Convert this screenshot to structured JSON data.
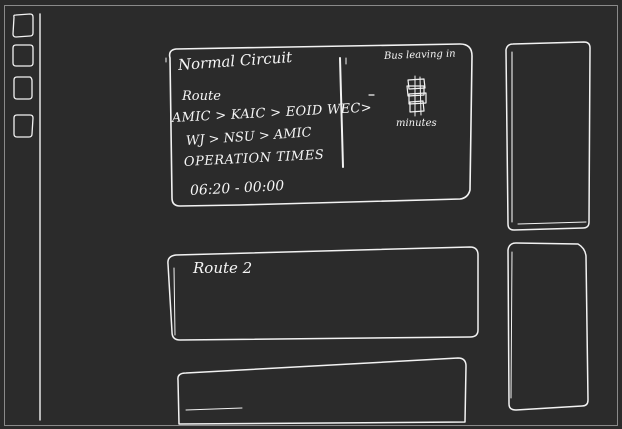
{
  "sidebar": {
    "items": [
      {
        "name": "sidebar-item-1"
      },
      {
        "name": "sidebar-item-2"
      },
      {
        "name": "sidebar-item-3"
      },
      {
        "name": "sidebar-item-4"
      }
    ]
  },
  "card_normal_circuit": {
    "title": "Normal Circuit",
    "route_label": "Route",
    "route_line1": "AMIC > KAIC > EOID WEC>",
    "route_line2": "WJ > NSU > AMIC",
    "operation_heading": "OPERATION TIMES",
    "operation_hours": "06:20 - 00:00",
    "bus_leaving_label": "Bus leaving in",
    "bus_leaving_unit": "minutes"
  },
  "card_route2": {
    "title": "Route 2"
  },
  "colors": {
    "background": "#2b2b2b",
    "stroke": "#f2f2f2"
  }
}
